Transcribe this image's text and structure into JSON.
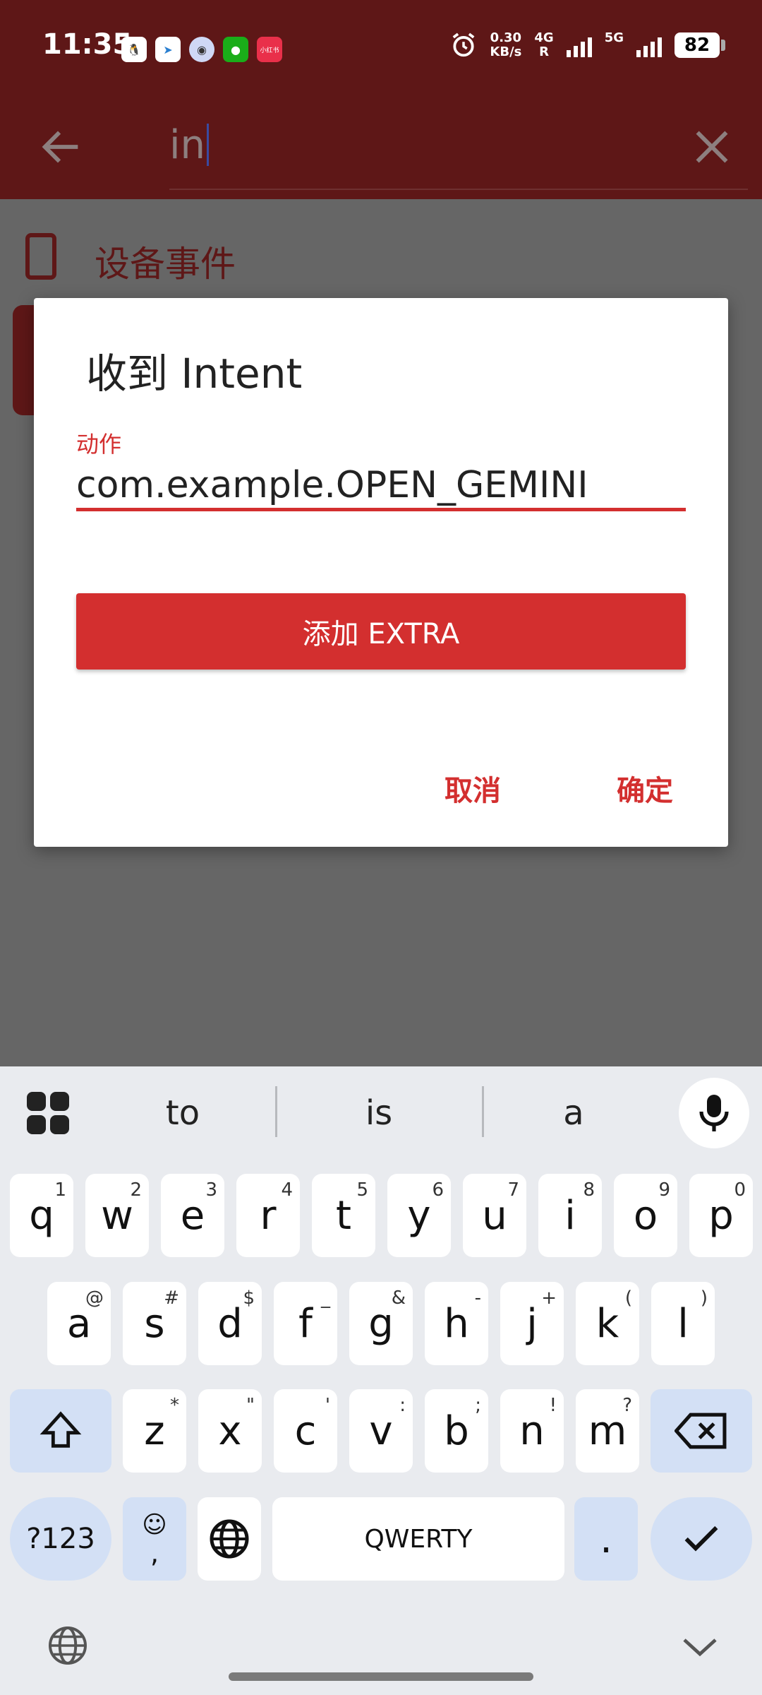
{
  "status_bar": {
    "time": "11:35",
    "net_speed_value": "0.30",
    "net_speed_unit": "KB/s",
    "net_4g": "4G",
    "net_r": "R",
    "net_5g": "5G",
    "battery": "82",
    "app_icons": [
      "qq-icon",
      "telegram-icon",
      "messenger-icon",
      "wechat-icon",
      "xiaohongshu-icon"
    ],
    "xiaohongshu_label": "小红书"
  },
  "app_bar": {
    "search_value": "in"
  },
  "background": {
    "category_label": "设备事件"
  },
  "dialog": {
    "title": "收到 Intent",
    "field_label": "动作",
    "field_value": "com.example.OPEN_GEMINI",
    "add_extra_label": "添加 EXTRA",
    "cancel_label": "取消",
    "ok_label": "确定"
  },
  "keyboard": {
    "suggestions": [
      "to",
      "is",
      "a"
    ],
    "row1": [
      {
        "k": "q",
        "s": "1"
      },
      {
        "k": "w",
        "s": "2"
      },
      {
        "k": "e",
        "s": "3"
      },
      {
        "k": "r",
        "s": "4"
      },
      {
        "k": "t",
        "s": "5"
      },
      {
        "k": "y",
        "s": "6"
      },
      {
        "k": "u",
        "s": "7"
      },
      {
        "k": "i",
        "s": "8"
      },
      {
        "k": "o",
        "s": "9"
      },
      {
        "k": "p",
        "s": "0"
      }
    ],
    "row2": [
      {
        "k": "a",
        "s": "@"
      },
      {
        "k": "s",
        "s": "#"
      },
      {
        "k": "d",
        "s": "$"
      },
      {
        "k": "f",
        "s": "_"
      },
      {
        "k": "g",
        "s": "&"
      },
      {
        "k": "h",
        "s": "-"
      },
      {
        "k": "j",
        "s": "+"
      },
      {
        "k": "k",
        "s": "("
      },
      {
        "k": "l",
        "s": ")"
      }
    ],
    "row3": [
      {
        "k": "z",
        "s": "*"
      },
      {
        "k": "x",
        "s": "\""
      },
      {
        "k": "c",
        "s": "'"
      },
      {
        "k": "v",
        "s": ":"
      },
      {
        "k": "b",
        "s": ";"
      },
      {
        "k": "n",
        "s": "!"
      },
      {
        "k": "m",
        "s": "?"
      }
    ],
    "symbols_label": "?123",
    "emoji_comma": ",",
    "space_label": "QWERTY",
    "period_label": "."
  },
  "colors": {
    "accent": "#d32f2f",
    "toolbar_dimmed": "#5e1717",
    "scrim": "#666666",
    "keyboard_bg": "#e9ebef",
    "mod_key": "#d3e0f5"
  }
}
